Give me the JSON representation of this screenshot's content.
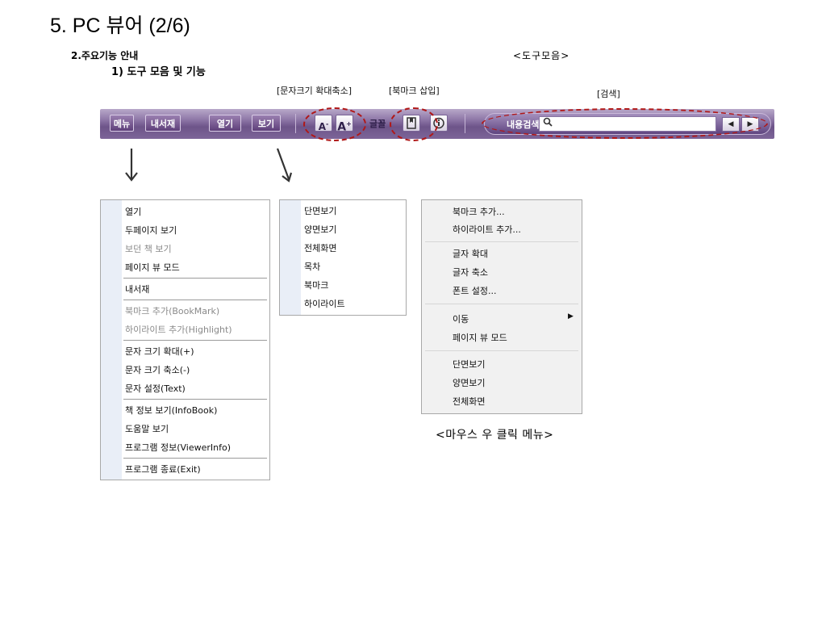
{
  "slide": {
    "title": "5. PC 뷰어 (2/6)",
    "section": "2.주요기능 안내",
    "subsection": "1) 도구 모음 및 기능"
  },
  "captions": {
    "toolbar": "<도구모음>",
    "font_size": "[문자크기 확대축소]",
    "bookmark": "[북마크 삽입]",
    "search": "[검색]",
    "context_menu": "<마우스 우 클릭 메뉴>"
  },
  "toolbar": {
    "buttons": [
      "메뉴",
      "내서재",
      "열기",
      "보기"
    ],
    "font_decrease": "A",
    "font_increase": "A",
    "font_decrease_sup": "-",
    "font_increase_sup": "+",
    "font_label": "글꼴",
    "search_label": "내용검색",
    "search_placeholder": ""
  },
  "menu_main": {
    "items": [
      {
        "label": "열기",
        "disabled": false
      },
      {
        "label": "두페이지 보기",
        "disabled": false
      },
      {
        "label": "보던 책 보기",
        "disabled": true
      },
      {
        "label": "페이지 뷰 모드",
        "disabled": false
      },
      {
        "label": "내서재",
        "disabled": false
      },
      {
        "label": "북마크 추가(BookMark)",
        "disabled": true
      },
      {
        "label": "하이라이트 추가(Highlight)",
        "disabled": true
      },
      {
        "label": "문자 크기 확대(+)",
        "disabled": false
      },
      {
        "label": "문자 크기 축소(-)",
        "disabled": false
      },
      {
        "label": "문자 설정(Text)",
        "disabled": false
      },
      {
        "label": "책 정보 보기(InfoBook)",
        "disabled": false
      },
      {
        "label": "도움말 보기",
        "disabled": false
      },
      {
        "label": "프로그램 정보(ViewerInfo)",
        "disabled": false
      },
      {
        "label": "프로그램 종료(Exit)",
        "disabled": false
      }
    ]
  },
  "menu_view": {
    "items": [
      "단면보기",
      "양면보기",
      "전체화면",
      "목차",
      "북마크",
      "하이라이트"
    ]
  },
  "menu_context": {
    "items": [
      "북마크 추가...",
      "하이라이트 추가...",
      "글자 확대",
      "글자 축소",
      "폰트 설정...",
      "이동",
      "페이지 뷰 모드",
      "단면보기",
      "양면보기",
      "전체화면"
    ]
  },
  "colors": {
    "toolbar": "#7d6598",
    "highlight": "#b01818",
    "arrow": "#333333"
  }
}
